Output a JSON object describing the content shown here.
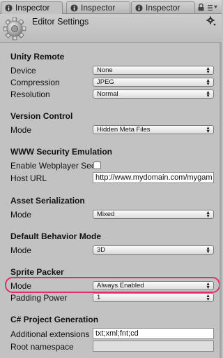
{
  "tabs": [
    {
      "label": "Inspector",
      "active": true
    },
    {
      "label": "Inspector",
      "active": false
    },
    {
      "label": "Inspector",
      "active": false
    }
  ],
  "header": {
    "title": "Editor Settings"
  },
  "sections": {
    "unity_remote": {
      "title": "Unity Remote",
      "device": {
        "label": "Device",
        "value": "None"
      },
      "compression": {
        "label": "Compression",
        "value": "JPEG"
      },
      "resolution": {
        "label": "Resolution",
        "value": "Normal"
      }
    },
    "version_control": {
      "title": "Version Control",
      "mode": {
        "label": "Mode",
        "value": "Hidden Meta Files"
      }
    },
    "www_security": {
      "title": "WWW Security Emulation",
      "enable_webplayer": {
        "label": "Enable Webplayer Secu",
        "checked": false
      },
      "host_url": {
        "label": "Host URL",
        "value": "http://www.mydomain.com/mygam"
      }
    },
    "asset_serialization": {
      "title": "Asset Serialization",
      "mode": {
        "label": "Mode",
        "value": "Mixed"
      }
    },
    "default_behavior": {
      "title": "Default Behavior Mode",
      "mode": {
        "label": "Mode",
        "value": "3D"
      }
    },
    "sprite_packer": {
      "title": "Sprite Packer",
      "mode": {
        "label": "Mode",
        "value": "Always Enabled"
      },
      "padding_power": {
        "label": "Padding Power",
        "value": "1"
      }
    },
    "csharp_project": {
      "title": "C# Project Generation",
      "additional_extensions": {
        "label": "Additional extensions",
        "value": "txt;xml;fnt;cd"
      },
      "root_namespace": {
        "label": "Root namespace",
        "value": ""
      }
    }
  },
  "colors": {
    "highlight": "#e0306c",
    "panel_bg": "#c2c2c2"
  },
  "icons": {
    "tab": "info-icon",
    "header": "gear-icon",
    "header_menu": "cog-menu-icon",
    "lock": "lock-icon",
    "tab_menu": "menu-icon"
  }
}
